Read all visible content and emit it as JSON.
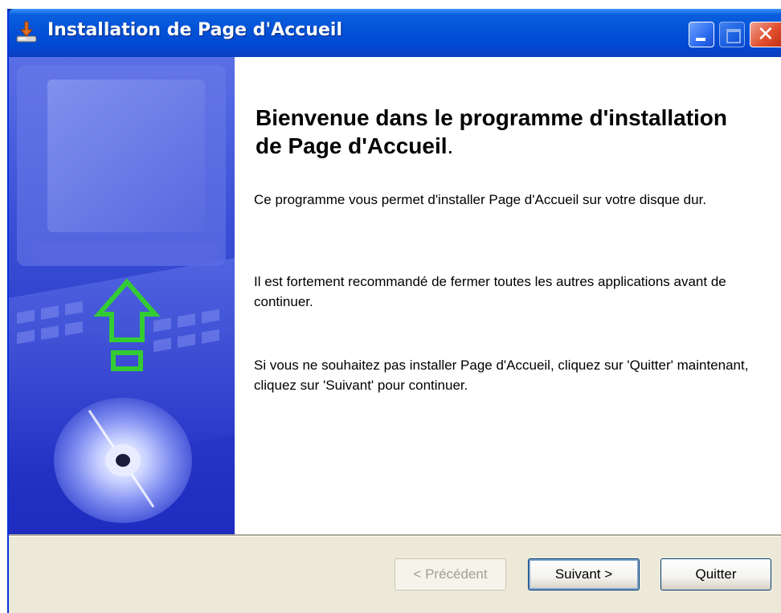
{
  "window": {
    "title": "Installation de Page d'Accueil"
  },
  "welcome": {
    "title": "Bienvenue dans le programme d'installation de Page d'Accueil",
    "title_dot": ".",
    "paragraph1": "Ce programme vous permet d'installer Page d'Accueil sur votre disque dur.",
    "paragraph2": "Il est fortement recommandé de fermer toutes les autres applications avant de continuer.",
    "paragraph3": "Si vous ne souhaitez pas installer Page d'Accueil, cliquez sur 'Quitter' maintenant, cliquez sur 'Suivant' pour continuer."
  },
  "buttons": {
    "previous": "< Précédent",
    "next": "Suivant >",
    "quit": "Quitter"
  },
  "titlebar_buttons": {
    "close_glyph": "✕"
  },
  "colors": {
    "titlebar": "#0352d6",
    "panel_blue": "#2e3fca",
    "arrow_green": "#33cc33",
    "button_face": "#ece9d8"
  },
  "icons": {
    "app": "installer-icon",
    "left_art": "monitor-keyboard-cd-illustration"
  }
}
